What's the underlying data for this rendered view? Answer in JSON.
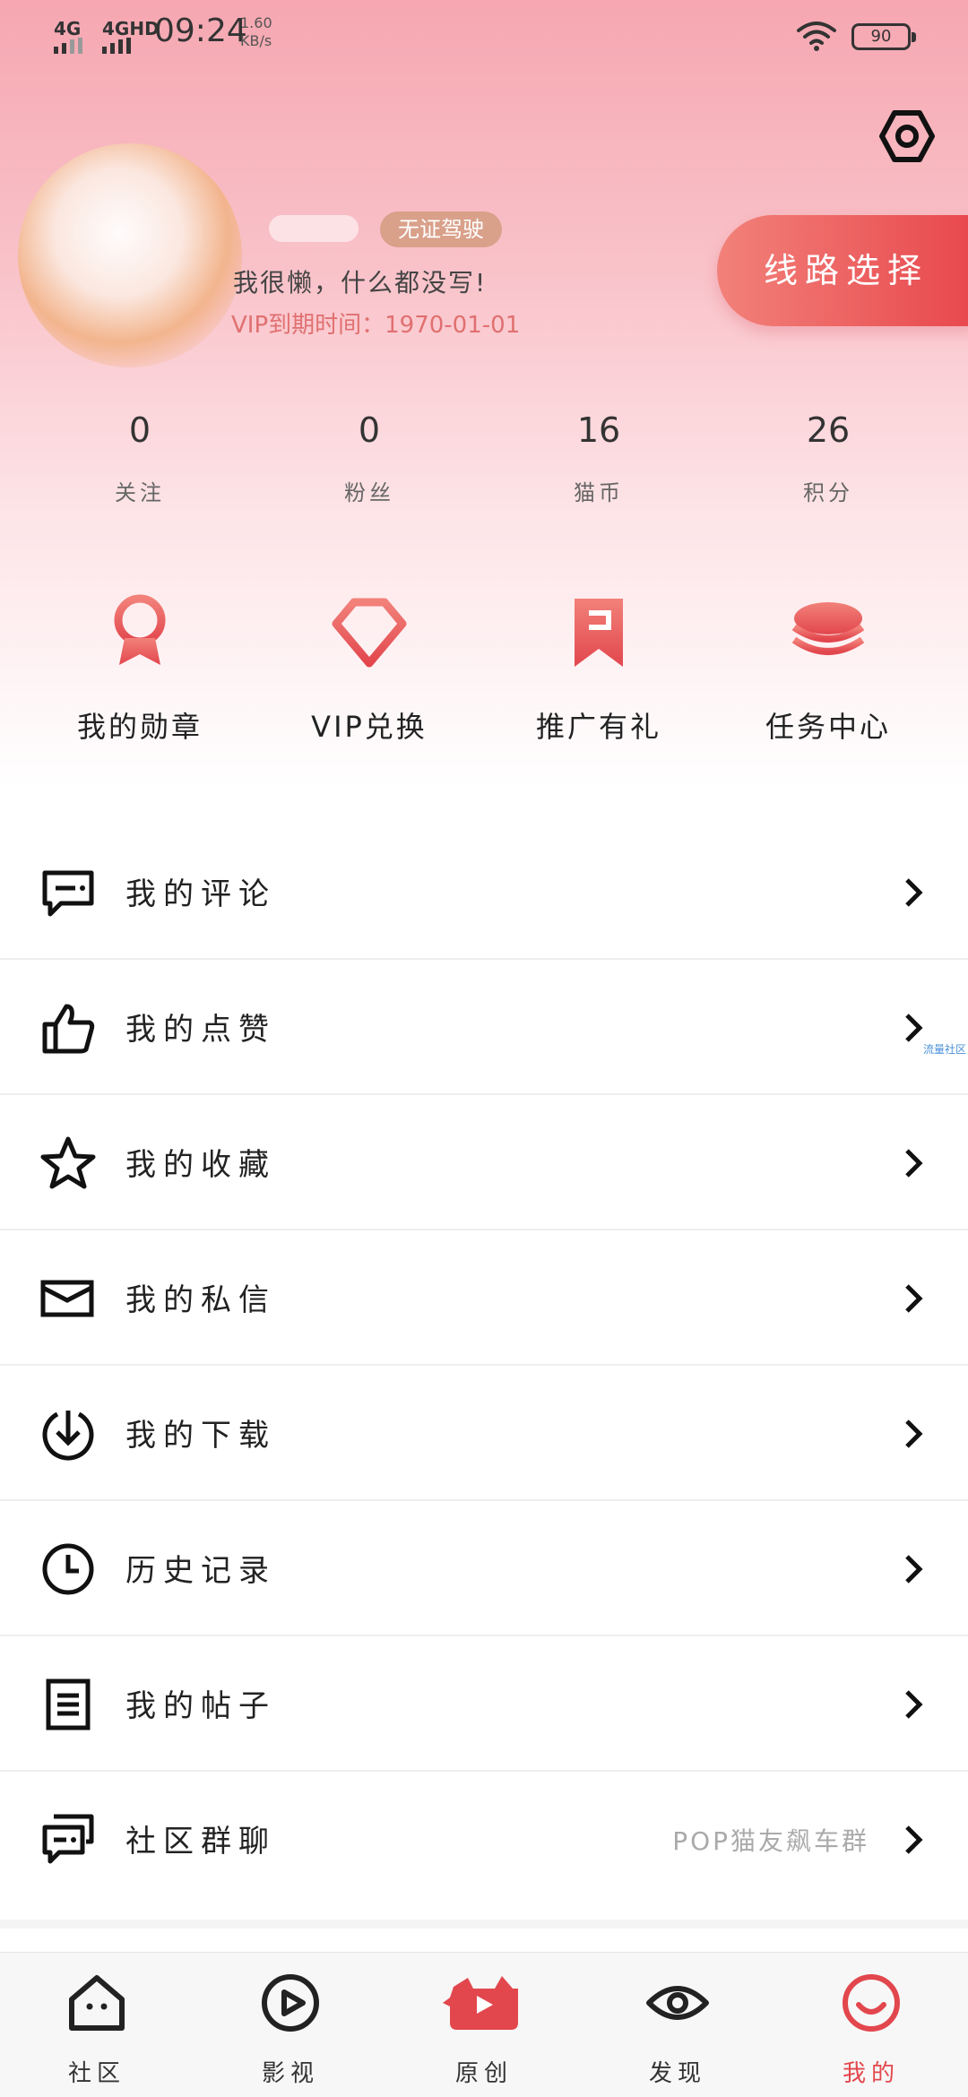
{
  "status_bar": {
    "signal1": "4G",
    "signal2": "4GHD",
    "time": "09:24",
    "net_speed_value": "1.60",
    "net_speed_unit": "KB/s",
    "battery": "90"
  },
  "profile": {
    "badge": "无证驾驶",
    "signature": "我很懒，什么都没写!",
    "vip_expire": "VIP到期时间：1970-01-01",
    "route_button": "线路选择"
  },
  "stats": [
    {
      "value": "0",
      "label": "关注"
    },
    {
      "value": "0",
      "label": "粉丝"
    },
    {
      "value": "16",
      "label": "猫币"
    },
    {
      "value": "26",
      "label": "积分"
    }
  ],
  "actions": [
    {
      "label": "我的勋章",
      "icon": "medal-icon"
    },
    {
      "label": "VIP兑换",
      "icon": "diamond-icon"
    },
    {
      "label": "推广有礼",
      "icon": "bookmark-icon"
    },
    {
      "label": "任务中心",
      "icon": "coin-stack-icon"
    }
  ],
  "menu": [
    {
      "label": "我的评论",
      "icon": "comment-icon",
      "sub": ""
    },
    {
      "label": "我的点赞",
      "icon": "thumbs-up-icon",
      "sub": ""
    },
    {
      "label": "我的收藏",
      "icon": "star-icon",
      "sub": ""
    },
    {
      "label": "我的私信",
      "icon": "envelope-icon",
      "sub": ""
    },
    {
      "label": "我的下载",
      "icon": "download-icon",
      "sub": ""
    },
    {
      "label": "历史记录",
      "icon": "clock-icon",
      "sub": ""
    },
    {
      "label": "我的帖子",
      "icon": "document-icon",
      "sub": ""
    },
    {
      "label": "社区群聊",
      "icon": "chat-icon",
      "sub": "POP猫友飙车群"
    }
  ],
  "watermark": "流量社区",
  "tabs": [
    {
      "label": "社区",
      "icon": "home-icon"
    },
    {
      "label": "影视",
      "icon": "play-icon"
    },
    {
      "label": "原创",
      "icon": "original-video-icon"
    },
    {
      "label": "发现",
      "icon": "eye-icon"
    },
    {
      "label": "我的",
      "icon": "smile-icon"
    }
  ],
  "colors": {
    "accent": "#e2474d",
    "hero_top": "#f6a7b1",
    "badge": "#d9a08a"
  }
}
